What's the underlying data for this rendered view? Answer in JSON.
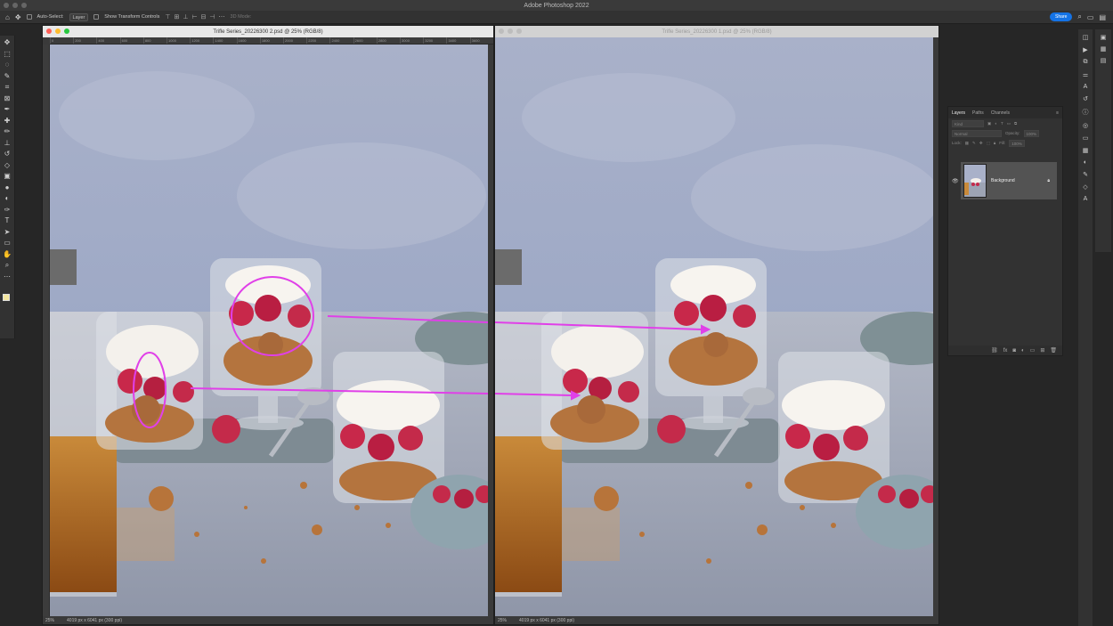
{
  "app": {
    "title": "Adobe Photoshop 2022"
  },
  "options_bar": {
    "auto_select_label": "Auto-Select:",
    "auto_select_value": "Layer",
    "transform_label": "Show Transform Controls",
    "mode_label": "3D Mode:",
    "share_label": "Share"
  },
  "toolbar": {
    "tools": [
      "move-tool",
      "marquee-tool",
      "lasso-tool",
      "quick-select-tool",
      "crop-tool",
      "frame-tool",
      "eyedropper-tool",
      "healing-tool",
      "brush-tool",
      "stamp-tool",
      "history-brush-tool",
      "eraser-tool",
      "gradient-tool",
      "blur-tool",
      "dodge-tool",
      "pen-tool",
      "type-tool",
      "path-select-tool",
      "shape-tool",
      "hand-tool",
      "zoom-tool",
      "more-tools"
    ],
    "glyphs": [
      "✥",
      "⬚",
      "◌",
      "✎",
      "⌗",
      "⊠",
      "✒",
      "✚",
      "✏",
      "⊥",
      "↺",
      "◇",
      "▣",
      "●",
      "◐",
      "✑",
      "T",
      "➤",
      "▭",
      "✋",
      "⌕",
      "⋯"
    ],
    "foreground_color": "#f4e7a0",
    "background_color": "#111111"
  },
  "documents": [
    {
      "title": "Trifle Series_20226300 2.psd @ 25% (RGB/8)",
      "active": true,
      "zoom": "25%",
      "info": "4019 px x 6041 px (300 ppi)",
      "ruler": [
        "0",
        "200",
        "400",
        "600",
        "800",
        "1000",
        "1200",
        "1400",
        "1600",
        "1800",
        "2000",
        "2200",
        "2400",
        "2600",
        "2800",
        "3000",
        "3200",
        "3400",
        "3600"
      ]
    },
    {
      "title": "Trifle Series_20226300 1.psd @ 25% (RGB/8)",
      "active": false,
      "zoom": "25%",
      "info": "4019 px x 6041 px (300 ppi)"
    }
  ],
  "layers_panel": {
    "tabs": [
      "Layers",
      "Paths",
      "Channels"
    ],
    "kind_label": "Kind",
    "blend_mode": "Normal",
    "opacity_label": "Opacity:",
    "opacity_value": "100%",
    "lock_label": "Lock:",
    "fill_label": "Fill:",
    "fill_value": "100%",
    "layer_name": "Background"
  },
  "colors": {
    "accent": "#1473e6",
    "annotation": "#e040e8",
    "backdrop": "#a9b4cc",
    "table": "#a6acba"
  }
}
